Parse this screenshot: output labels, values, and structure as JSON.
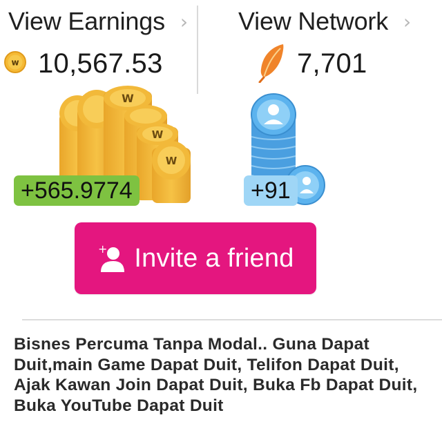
{
  "earnings": {
    "link_label": "View Earnings",
    "chevron_icon": "chevron-right-icon",
    "coin_icon": "w-coin-icon",
    "total": "10,567.53",
    "increment": "+565.9774",
    "coin_letter": "W",
    "accent_color": "#7ec241"
  },
  "network": {
    "link_label": "View Network",
    "chevron_icon": "chevron-right-icon",
    "feather_icon": "feather-icon",
    "total": "7,701",
    "increment": "+91",
    "accent_color": "#9fd6f6"
  },
  "invite": {
    "label": "Invite a friend",
    "icon": "add-user-icon",
    "color": "#e4167f"
  },
  "description": "Bisnes Percuma Tanpa Modal.. Guna Dapat Duit,main Game Dapat Duit, Telifon Dapat Duit, Ajak Kawan Join Dapat Duit, Buka Fb Dapat Duit, Buka YouTube Dapat Duit"
}
